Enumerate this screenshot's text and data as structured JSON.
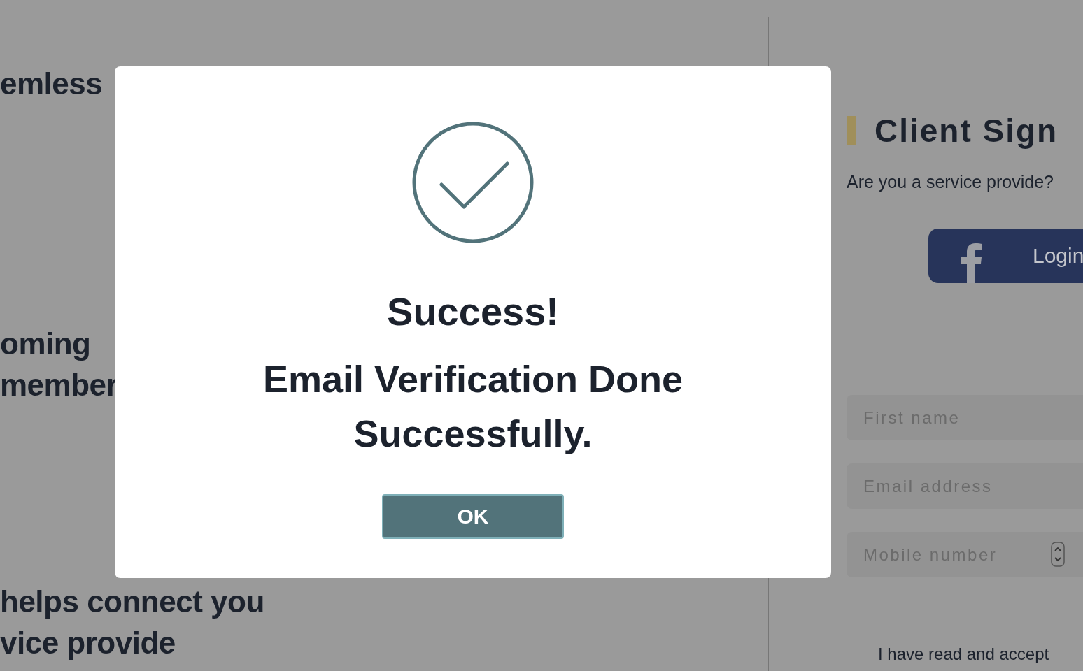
{
  "background": {
    "headings": [
      {
        "lines": [
          "emless"
        ]
      },
      {
        "lines": [
          "oming",
          "member"
        ]
      },
      {
        "lines": [
          "helps connect you",
          "vice provide"
        ]
      }
    ]
  },
  "signup": {
    "title": "Client Sign",
    "subtitle": "Are you a service provide?",
    "facebook_button": "Login",
    "fields": [
      {
        "kind": "text",
        "placeholder": "First name"
      },
      {
        "kind": "text",
        "placeholder": "Email address"
      },
      {
        "kind": "number",
        "placeholder": "Mobile number"
      }
    ],
    "terms": "I have read and accept"
  },
  "dialog": {
    "heading": "Success!",
    "message": "Email Verification Done Successfully.",
    "button": "OK"
  }
}
